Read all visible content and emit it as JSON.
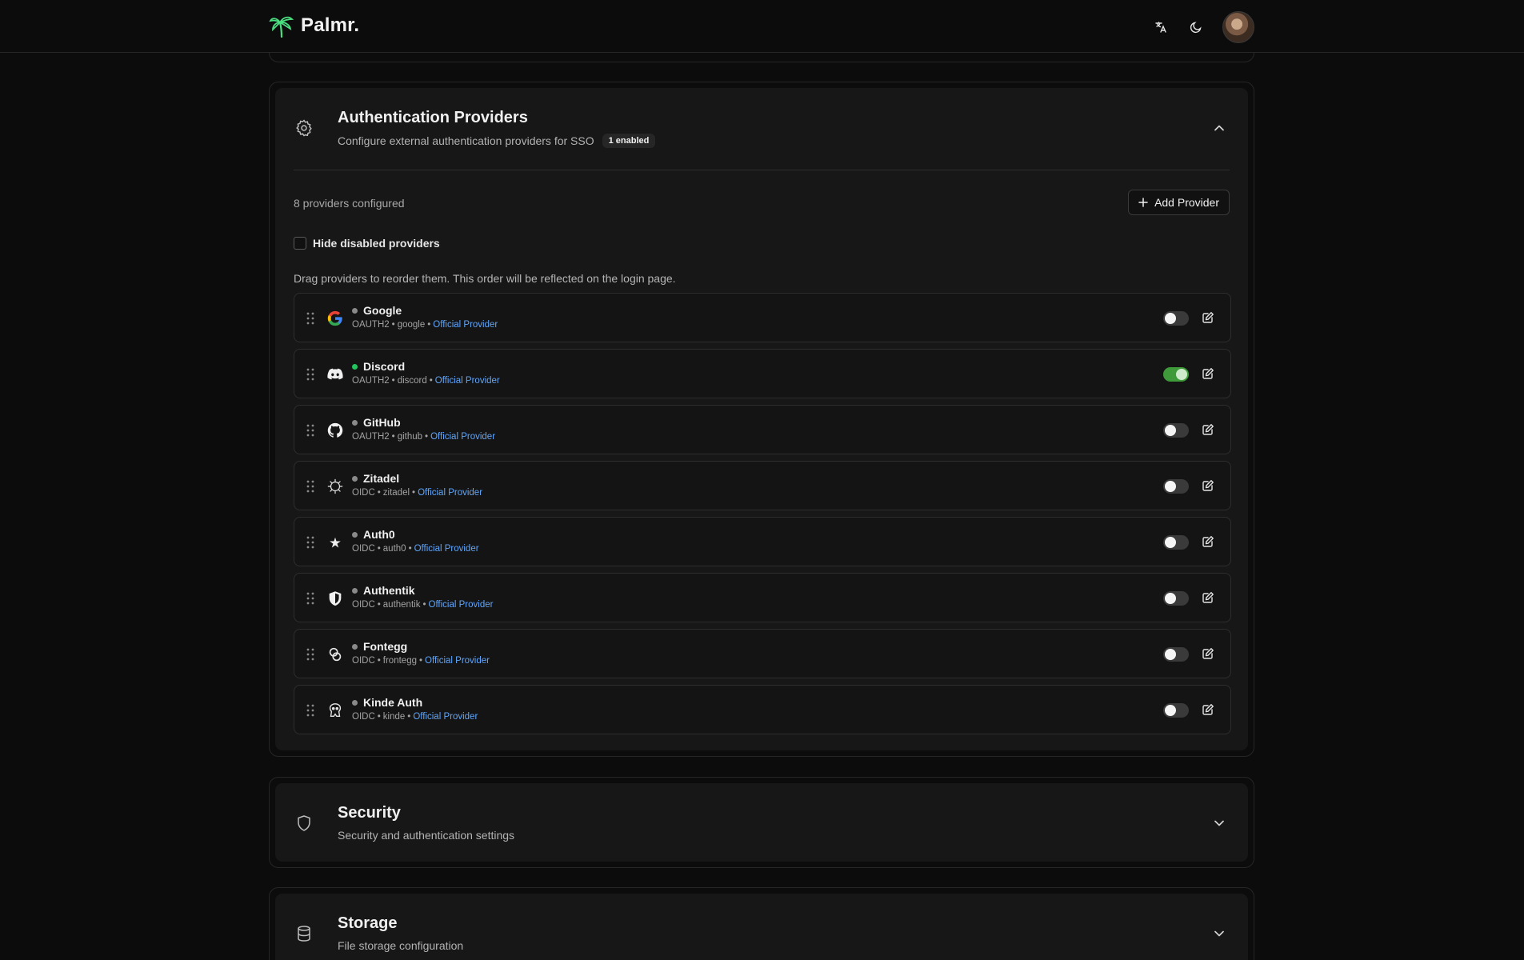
{
  "brand": {
    "name": "Palmr."
  },
  "auth_section": {
    "title": "Authentication Providers",
    "subtitle": "Configure external authentication providers for SSO",
    "badge": "1 enabled",
    "count_text": "8 providers configured",
    "add_label": "Add Provider",
    "hide_disabled_label": "Hide disabled providers",
    "hint": "Drag providers to reorder them. This order will be reflected on the login page.",
    "providers": [
      {
        "name": "Google",
        "type": "OAUTH2",
        "slug": "google",
        "tag": "Official Provider",
        "enabled": false,
        "icon": "google-icon"
      },
      {
        "name": "Discord",
        "type": "OAUTH2",
        "slug": "discord",
        "tag": "Official Provider",
        "enabled": true,
        "icon": "discord-icon"
      },
      {
        "name": "GitHub",
        "type": "OAUTH2",
        "slug": "github",
        "tag": "Official Provider",
        "enabled": false,
        "icon": "github-icon"
      },
      {
        "name": "Zitadel",
        "type": "OIDC",
        "slug": "zitadel",
        "tag": "Official Provider",
        "enabled": false,
        "icon": "zitadel-icon"
      },
      {
        "name": "Auth0",
        "type": "OIDC",
        "slug": "auth0",
        "tag": "Official Provider",
        "enabled": false,
        "icon": "auth0-icon"
      },
      {
        "name": "Authentik",
        "type": "OIDC",
        "slug": "authentik",
        "tag": "Official Provider",
        "enabled": false,
        "icon": "authentik-icon"
      },
      {
        "name": "Fontegg",
        "type": "OIDC",
        "slug": "frontegg",
        "tag": "Official Provider",
        "enabled": false,
        "icon": "frontegg-icon"
      },
      {
        "name": "Kinde Auth",
        "type": "OIDC",
        "slug": "kinde",
        "tag": "Official Provider",
        "enabled": false,
        "icon": "kinde-icon"
      }
    ]
  },
  "security_section": {
    "title": "Security",
    "subtitle": "Security and authentication settings"
  },
  "storage_section": {
    "title": "Storage",
    "subtitle": "File storage configuration"
  },
  "colors": {
    "accent_green": "#3f9b3a",
    "link_blue": "#60a5fa",
    "background": "#0c0c0c",
    "card": "#171717"
  }
}
